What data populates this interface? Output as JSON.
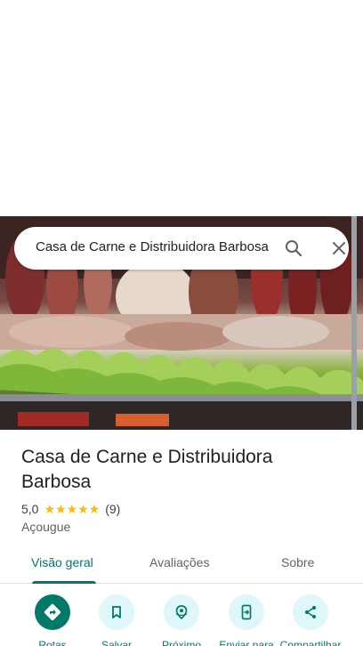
{
  "search": {
    "query": "Casa de Carne e Distribuidora Barbosa"
  },
  "place": {
    "name": "Casa de Carne e Distribuidora Barbosa",
    "rating": "5,0",
    "stars": "★★★★★",
    "review_count": "(9)",
    "category": "Açougue"
  },
  "tabs": [
    {
      "label": "Visão geral",
      "active": true
    },
    {
      "label": "Avaliações",
      "active": false
    },
    {
      "label": "Sobre",
      "active": false
    }
  ],
  "actions": [
    {
      "label": "Rotas",
      "icon": "directions-icon"
    },
    {
      "label": "Salvar",
      "icon": "bookmark-icon"
    },
    {
      "label": "Próximo",
      "icon": "nearby-icon"
    },
    {
      "label": "Enviar para",
      "icon": "send-to-phone-icon"
    },
    {
      "label": "Compartilhar",
      "icon": "share-icon"
    }
  ],
  "colors": {
    "accent": "#00796b",
    "action_bg": "#e0f7fa",
    "star": "#fbbc04"
  }
}
